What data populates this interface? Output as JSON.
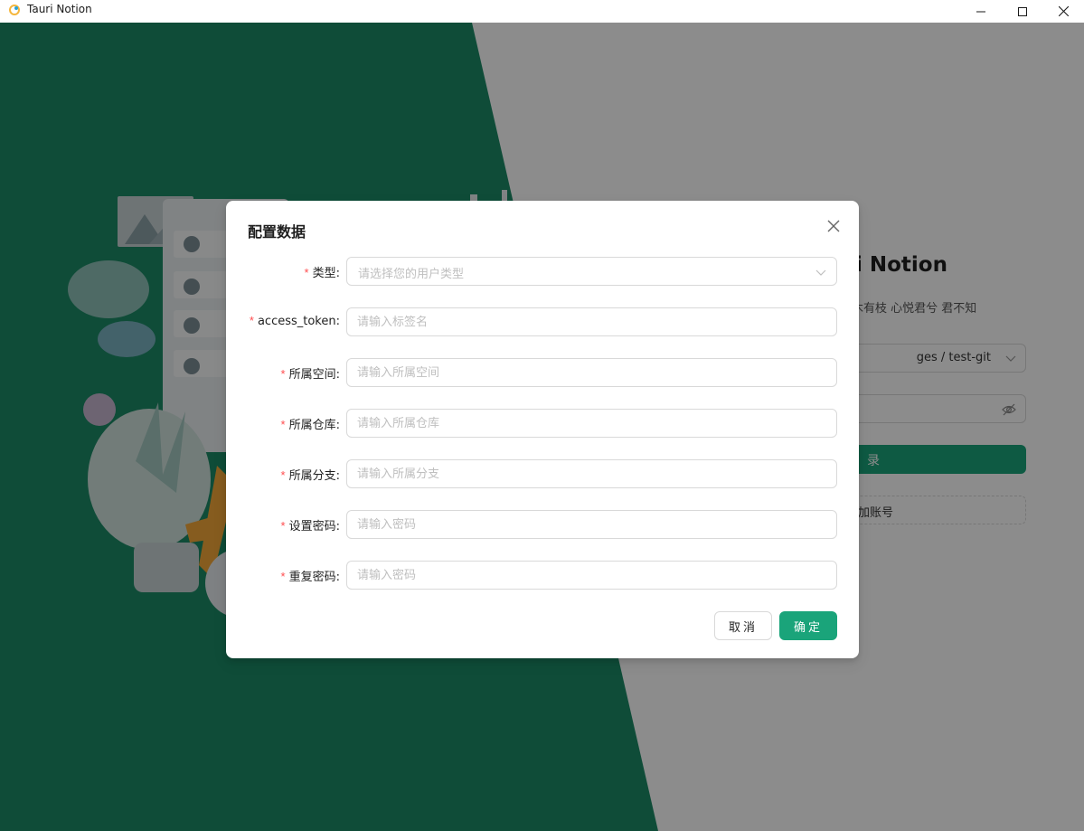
{
  "window": {
    "title": "Tauri Notion"
  },
  "login": {
    "app_title": "Tauri Notion",
    "subtitle": "山有木兮木有枝 心悦君兮 君不知",
    "repo_select_value": "ges / test-git",
    "login_button": "登 录",
    "add_account_button": "添加账号"
  },
  "modal": {
    "title": "配置数据",
    "fields": [
      {
        "label": "类型:",
        "placeholder": "请选择您的用户类型",
        "type": "select"
      },
      {
        "label": "access_token:",
        "placeholder": "请输入标签名",
        "type": "input"
      },
      {
        "label": "所属空间:",
        "placeholder": "请输入所属空间",
        "type": "input"
      },
      {
        "label": "所属仓库:",
        "placeholder": "请输入所属仓库",
        "type": "input"
      },
      {
        "label": "所属分支:",
        "placeholder": "请输入所属分支",
        "type": "input"
      },
      {
        "label": "设置密码:",
        "placeholder": "请输入密码",
        "type": "input"
      },
      {
        "label": "重复密码:",
        "placeholder": "请输入密码",
        "type": "input"
      }
    ],
    "cancel_label": "取消",
    "ok_label": "确定"
  },
  "colors": {
    "brand_green": "#1aa47a",
    "dark_green_bg": "#1d8a66",
    "required_star": "#ff4d4f"
  },
  "icons": [
    "app-logo-icon",
    "minimize-icon",
    "maximize-icon",
    "close-icon",
    "chevron-down-icon",
    "eye-invisible-icon",
    "modal-close-icon"
  ]
}
